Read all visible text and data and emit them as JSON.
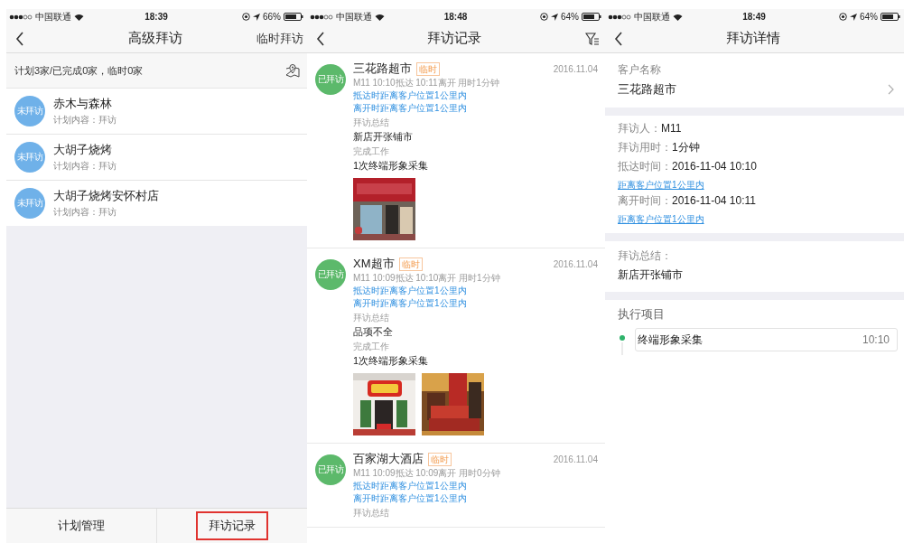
{
  "plan_screen": {
    "status_bar": {
      "carrier": "中国联通",
      "time": "18:39",
      "battery": "66%"
    },
    "nav": {
      "title": "高级拜访",
      "action": "临时拜访"
    },
    "summary": "计划3家/已完成0家，临时0家",
    "plans": [
      {
        "badge": "未拜访",
        "name": "赤木与森林",
        "detail": "计划内容：拜访"
      },
      {
        "badge": "未拜访",
        "name": "大胡子烧烤",
        "detail": "计划内容：拜访"
      },
      {
        "badge": "未拜访",
        "name": "大胡子烧烤安怀村店",
        "detail": "计划内容：拜访"
      }
    ],
    "tabs": [
      {
        "label": "计划管理",
        "highlighted": false
      },
      {
        "label": "拜访记录",
        "highlighted": true
      }
    ]
  },
  "records_screen": {
    "status_bar": {
      "carrier": "中国联通",
      "time": "18:48",
      "battery": "64%"
    },
    "nav": {
      "title": "拜访记录"
    },
    "records": [
      {
        "badge": "已拜访",
        "name": "三花路超市",
        "tag": "临时",
        "date": "2016.11.04",
        "meta": "M11  10:10抵达  10:11离开  用时1分钟",
        "arrive_note": "抵达时距离客户位置1公里内",
        "leave_note": "离开时距离客户位置1公里内",
        "summary_label": "拜访总结",
        "summary": "新店开张铺市",
        "work_label": "完成工作",
        "work": "1次终端形象采集"
      },
      {
        "badge": "已拜访",
        "name": "XM超市",
        "tag": "临时",
        "date": "2016.11.04",
        "meta": "M11  10:09抵达  10:10离开  用时1分钟",
        "arrive_note": "抵达时距离客户位置1公里内",
        "leave_note": "离开时距离客户位置1公里内",
        "summary_label": "拜访总结",
        "summary": "品项不全",
        "work_label": "完成工作",
        "work": "1次终端形象采集"
      },
      {
        "badge": "已拜访",
        "name": "百家湖大酒店",
        "tag": "临时",
        "date": "2016.11.04",
        "meta": "M11  10:09抵达  10:09离开  用时0分钟",
        "arrive_note": "抵达时距离客户位置1公里内",
        "leave_note": "离开时距离客户位置1公里内",
        "summary_label": "拜访总结"
      }
    ]
  },
  "detail_screen": {
    "status_bar": {
      "carrier": "中国联通",
      "time": "18:49",
      "battery": "64%"
    },
    "nav": {
      "title": "拜访详情"
    },
    "customer_label": "客户名称",
    "customer_name": "三花路超市",
    "info": [
      {
        "kind": "field",
        "label": "拜访人：",
        "value": "M11"
      },
      {
        "kind": "field",
        "label": "拜访用时：",
        "value": "1分钟"
      },
      {
        "kind": "field",
        "label": "抵达时间：",
        "value": "2016-11-04 10:10"
      },
      {
        "kind": "link",
        "text": "距离客户位置1公里内"
      },
      {
        "kind": "field",
        "label": "离开时间：",
        "value": "2016-11-04 10:11"
      },
      {
        "kind": "link",
        "text": "距离客户位置1公里内"
      }
    ],
    "summary_label": "拜访总结：",
    "summary": "新店开张铺市",
    "tasks_label": "执行项目",
    "tasks": [
      {
        "name": "终端形象采集",
        "time": "10:10"
      }
    ]
  }
}
